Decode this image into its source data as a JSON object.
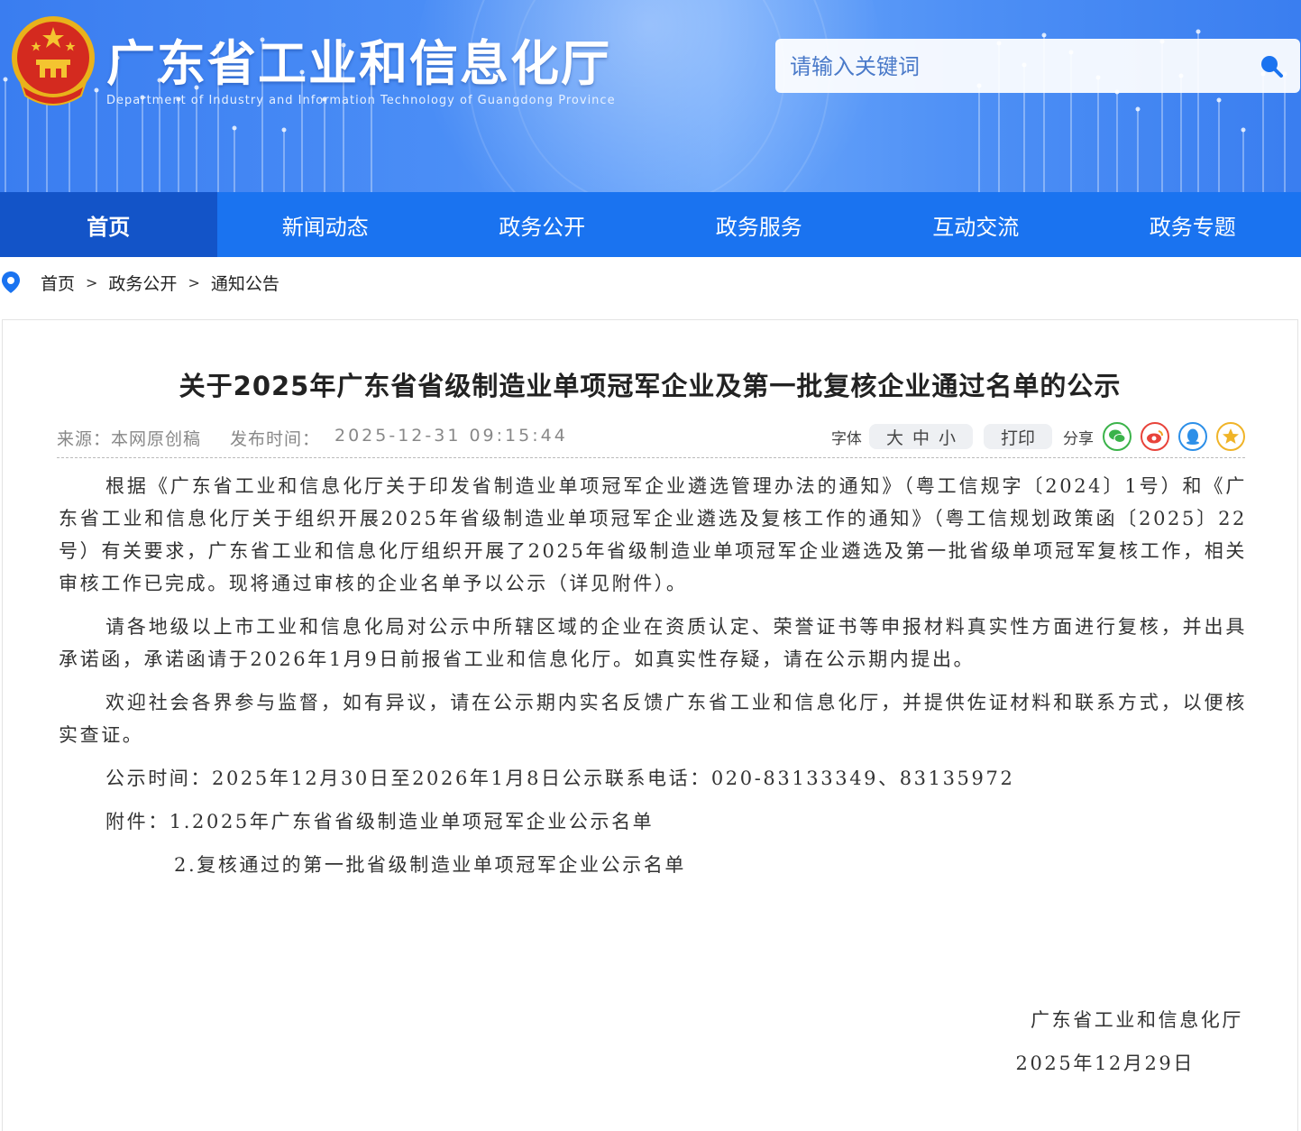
{
  "header": {
    "site_title": "广东省工业和信息化厅",
    "site_subtitle": "Department of Industry and Information Technology of Guangdong Province",
    "search_placeholder": "请输入关键词"
  },
  "nav": {
    "items": [
      "首页",
      "新闻动态",
      "政务公开",
      "政务服务",
      "互动交流",
      "政务专题"
    ],
    "active": "首页"
  },
  "breadcrumb": {
    "items": [
      "首页",
      "政务公开",
      "通知公告"
    ],
    "separator": ">"
  },
  "article": {
    "title": "关于2025年广东省省级制造业单项冠军企业及第一批复核企业通过名单的公示",
    "source": "来源：本网原创稿",
    "publish_label": "发布时间：",
    "publish_time": "2025-12-31 09:15:44",
    "tools": {
      "font_label": "字体",
      "font_sizes": [
        "大",
        "中",
        "小"
      ],
      "print_label": "打印",
      "share_label": "分享",
      "share_icons": [
        "wechat-icon",
        "weibo-icon",
        "qq-icon",
        "qzone-icon"
      ]
    },
    "paragraphs": [
      "根据《广东省工业和信息化厅关于印发省制造业单项冠军企业遴选管理办法的通知》（粤工信规字〔2024〕1号）和《广东省工业和信息化厅关于组织开展2025年省级制造业单项冠军企业遴选及复核工作的通知》（粤工信规划政策函〔2025〕22号）有关要求，广东省工业和信息化厅组织开展了2025年省级制造业单项冠军企业遴选及第一批省级单项冠军复核工作，相关审核工作已完成。现将通过审核的企业名单予以公示（详见附件）。",
      "请各地级以上市工业和信息化局对公示中所辖区域的企业在资质认定、荣誉证书等申报材料真实性方面进行复核，并出具承诺函，承诺函请于2026年1月9日前报省工业和信息化厅。如真实性存疑，请在公示期内提出。",
      "欢迎社会各界参与监督，如有异议，请在公示期内实名反馈广东省工业和信息化厅，并提供佐证材料和联系方式，以便核实查证。"
    ],
    "notice_line": "公示时间：2025年12月30日至2026年1月8日公示联系电话：020-83133349、83135972",
    "attachment_1": "附件：1.2025年广东省省级制造业单项冠军企业公示名单",
    "attachment_2": "2.复核通过的第一批省级制造业单项冠军企业公示名单",
    "signature_org": "广东省工业和信息化厅",
    "signature_date": "2025年12月29日"
  },
  "colors": {
    "nav_bg": "#1a73f0",
    "nav_active": "#1354c8",
    "banner": "#4b8ef6",
    "wechat": "#3bb34a",
    "weibo": "#e8433a",
    "qq": "#2c8fe8",
    "qzone": "#f0b428"
  }
}
